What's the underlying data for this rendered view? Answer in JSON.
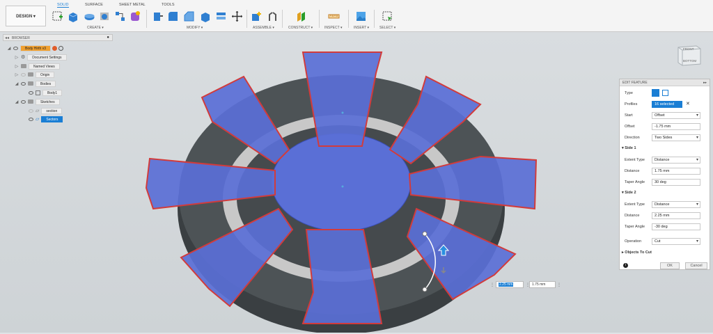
{
  "toolbar": {
    "design_label": "DESIGN ▾",
    "tabs": [
      "SOLID",
      "SURFACE",
      "SHEET METAL",
      "TOOLS"
    ],
    "groups": {
      "create": "CREATE ▾",
      "modify": "MODIFY ▾",
      "assemble": "ASSEMBLE ▾",
      "construct": "CONSTRUCT ▾",
      "inspect": "INSPECT ▾",
      "insert": "INSERT ▾",
      "select": "SELECT ▾"
    }
  },
  "browser": {
    "title": "BROWSER",
    "items": {
      "root": "Body Hirth v3",
      "doc_settings": "Document Settings",
      "named_views": "Named Views",
      "origin": "Origin",
      "bodies": "Bodies",
      "body1": "Body1",
      "sketches": "Sketches",
      "section": "section",
      "sectors": "Sectors"
    }
  },
  "viewcube": {
    "front": "FRONT",
    "bottom": "BOTTOM"
  },
  "edit_feature": {
    "title": "EDIT FEATURE",
    "type_label": "Type",
    "profiles_label": "Profiles",
    "profiles_value": "16 selected",
    "start_label": "Start",
    "start_value": "Offset",
    "offset_label": "Offset",
    "offset_value": "-1.75 mm",
    "direction_label": "Direction",
    "direction_value": "Two Sides",
    "side1_label": "Side 1",
    "side1_extent_label": "Extent Type",
    "side1_extent_value": "Distance",
    "side1_distance_label": "Distance",
    "side1_distance_value": "1.75 mm",
    "side1_taper_label": "Taper Angle",
    "side1_taper_value": "30 deg",
    "side2_label": "Side 2",
    "side2_extent_label": "Extent Type",
    "side2_extent_value": "Distance",
    "side2_distance_label": "Distance",
    "side2_distance_value": "2.25 mm",
    "side2_taper_label": "Taper Angle",
    "side2_taper_value": "-30 deg",
    "operation_label": "Operation",
    "operation_value": "Cut",
    "objects_to_cut_label": "Objects To Cut",
    "ok_label": "OK",
    "cancel_label": "Cancel"
  },
  "dimension_inputs": {
    "side2": "2.25 mm",
    "side1": "1.75 mm"
  },
  "colors": {
    "accent": "#1a7ed4",
    "blue_fill": "#5a6fd6",
    "red_edge": "#d23b3b",
    "body_gray": "#4a4f52"
  }
}
